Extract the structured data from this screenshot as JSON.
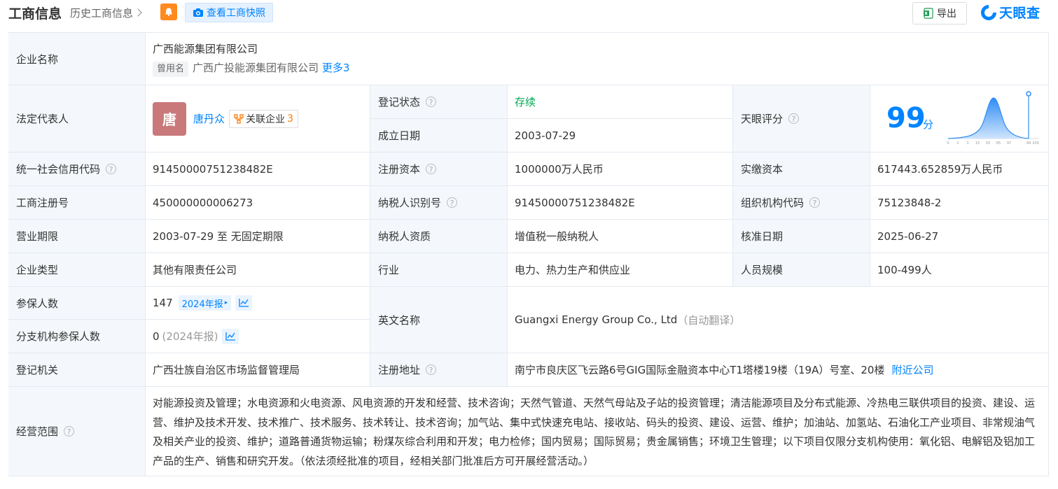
{
  "header": {
    "title": "工商信息",
    "history": "历史工商信息",
    "snapshot": "查看工商快照",
    "export": "导出",
    "brand": "天眼查"
  },
  "rows": {
    "name_label": "企业名称",
    "name_value": "广西能源集团有限公司",
    "former_tag": "曾用名",
    "former_value": "广西广投能源集团有限公司",
    "former_more": "更多3",
    "legal_label": "法定代表人",
    "legal_avatar": "唐",
    "legal_name": "唐丹众",
    "related_label": "关联企业",
    "related_count": "3",
    "status_label": "登记状态",
    "status_value": "存续",
    "founded_label": "成立日期",
    "founded_value": "2003-07-29",
    "score_label": "天眼评分",
    "score_value": "99",
    "score_unit": "分",
    "score_ticks": [
      "0",
      "1",
      "3",
      "15",
      "50",
      "85",
      "97",
      "99",
      "100"
    ],
    "credit_label": "统一社会信用代码",
    "credit_value": "91450000751238482E",
    "capital_label": "注册资本",
    "capital_value": "1000000万人民币",
    "paid_label": "实缴资本",
    "paid_value": "617443.652859万人民币",
    "regno_label": "工商注册号",
    "regno_value": "450000000006273",
    "taxid_label": "纳税人识别号",
    "taxid_value": "91450000751238482E",
    "org_label": "组织机构代码",
    "org_value": "75123848-2",
    "term_label": "营业期限",
    "term_value": "2003-07-29 至 无固定期限",
    "taxq_label": "纳税人资质",
    "taxq_value": "增值税一般纳税人",
    "approve_label": "核准日期",
    "approve_value": "2025-06-27",
    "type_label": "企业类型",
    "type_value": "其他有限责任公司",
    "industry_label": "行业",
    "industry_value": "电力、热力生产和供应业",
    "staff_label": "人员规模",
    "staff_value": "100-499人",
    "insured_label": "参保人数",
    "insured_value": "147",
    "insured_year": "2024年报",
    "en_label": "英文名称",
    "en_value": "Guangxi Energy Group Co., Ltd",
    "en_note": "（自动翻译）",
    "branch_label": "分支机构参保人数",
    "branch_value": "0",
    "branch_year": "(2024年报)",
    "authority_label": "登记机关",
    "authority_value": "广西壮族自治区市场监督管理局",
    "address_label": "注册地址",
    "address_value": "南宁市良庆区飞云路6号GIG国际金融资本中心T1塔楼19楼（19A）号室、20楼",
    "address_link": "附近公司",
    "scope_label": "经营范围",
    "scope_value": "对能源投资及管理；水电资源和火电资源、风电资源的开发和经营、技术咨询；天然气管道、天然气母站及子站的投资管理；清洁能源项目及分布式能源、冷热电三联供项目的投资、建设、运营、维护及技术开发、技术推广、技术服务、技术转让、技术咨询；加气站、集中式快速充电站、接收站、码头的投资、建设、运营、维护；加油站、加氢站、石油化工产业项目、非常规油气及相关产业的投资、维护；道路普通货物运输；粉煤灰综合利用和开发；电力检修；国内贸易；国际贸易；贵金属销售；环境卫生管理；以下项目仅限分支机构使用：氧化铝、电解铝及铝加工产品的生产、销售和研究开发。（依法须经批准的项目，经相关部门批准后方可开展经营活动。）"
  }
}
